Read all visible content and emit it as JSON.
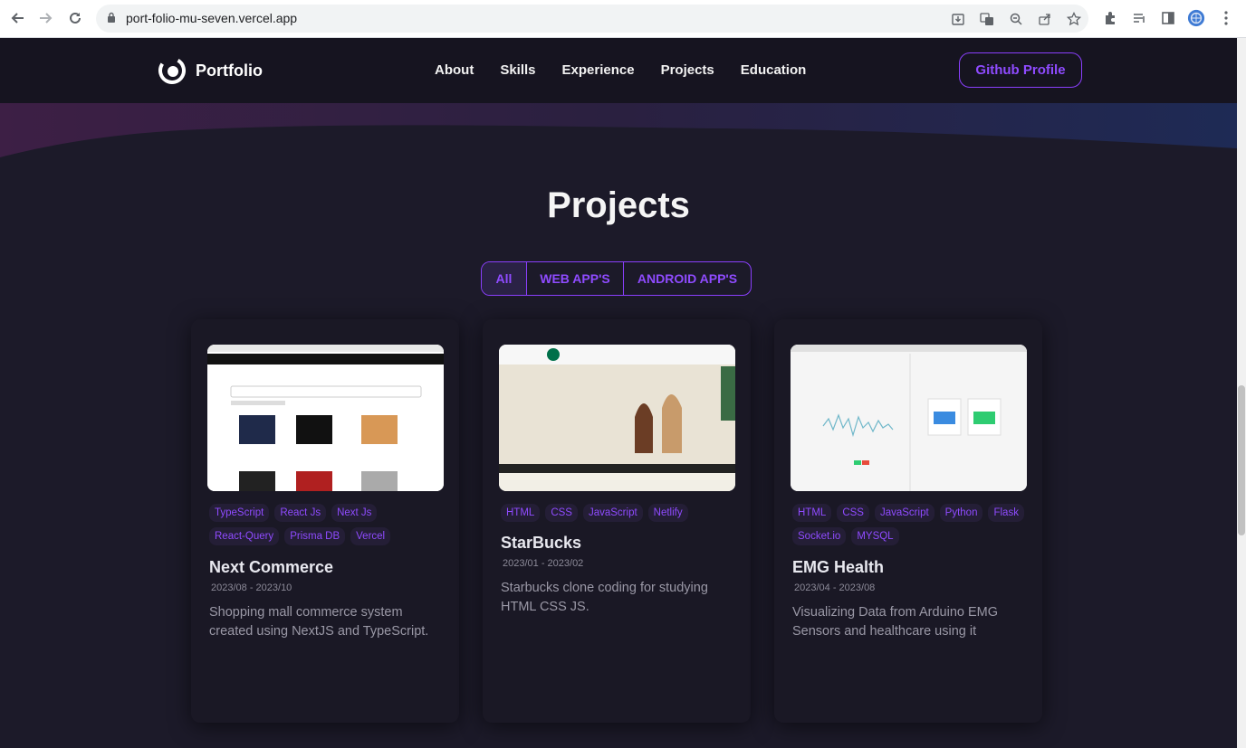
{
  "browser": {
    "url": "port-folio-mu-seven.vercel.app",
    "back_icon": "arrow-left-icon",
    "forward_icon": "arrow-right-icon",
    "reload_icon": "reload-icon"
  },
  "navbar": {
    "brand": "Portfolio",
    "links": [
      "About",
      "Skills",
      "Experience",
      "Projects",
      "Education"
    ],
    "github_button": "Github Profile",
    "accent": "#8a3ffc"
  },
  "projects": {
    "title": "Projects",
    "tabs": [
      "All",
      "WEB APP'S",
      "ANDROID APP'S"
    ],
    "active_tab": "All",
    "cards": [
      {
        "tags": [
          "TypeScript",
          "React Js",
          "Next Js",
          "React-Query",
          "Prisma DB",
          "Vercel"
        ],
        "title": "Next Commerce",
        "date": "2023/08 - 2023/10",
        "description": "Shopping mall commerce system created using NextJS and TypeScript."
      },
      {
        "tags": [
          "HTML",
          "CSS",
          "JavaScript",
          "Netlify"
        ],
        "title": "StarBucks",
        "date": "2023/01 - 2023/02",
        "description": "Starbucks clone coding for studying HTML CSS JS."
      },
      {
        "tags": [
          "HTML",
          "CSS",
          "JavaScript",
          "Python",
          "Flask",
          "Socket.io",
          "MYSQL"
        ],
        "title": "EMG Health",
        "date": "2023/04 - 2023/08",
        "description": "Visualizing Data from Arduino EMG Sensors and healthcare using it"
      }
    ]
  }
}
